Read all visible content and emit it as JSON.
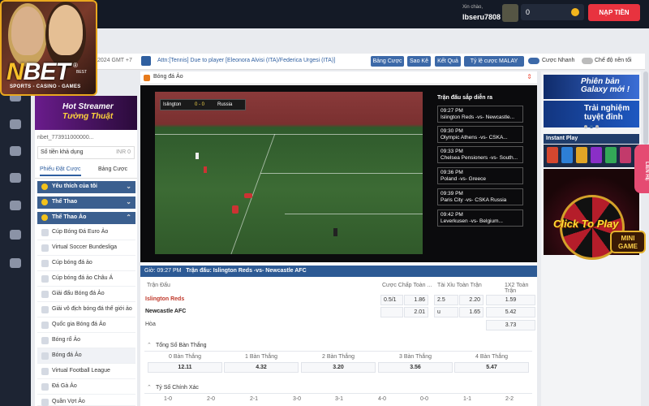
{
  "header": {
    "logo_text_a": "N",
    "logo_text_b": "BET",
    "logo_reg": "®",
    "logo_best": "BEST",
    "logo_tagline": "SPORTS - CASINO - GAMES",
    "greeting": "Xin chào,",
    "username": "lbseru7808",
    "balance": "0",
    "deposit_label": "NẠP TIỀN"
  },
  "leftpanel": {
    "promo_line1": "Hot Streamer",
    "promo_line2": "Tường Thuật",
    "account": "nbet_773911000000...",
    "balance_label": "Số tiền khả dụng",
    "balance_value": "INR 0",
    "tab1": "Phiếu Đặt Cược",
    "tab2": "Bảng Cược",
    "sections": {
      "favorites": "Yêu thích của tôi",
      "sports": "Thể Thao",
      "virtual": "Thể Thao Ảo"
    },
    "items": [
      "Cúp Bóng Đá Euro Ảo",
      "Virtual Soccer Bundesliga",
      "Cúp bóng đá ảo",
      "Cúp bóng đá ảo Châu Á",
      "Giải đấu Bóng đá Ảo",
      "Giải vô địch bóng đá thế giới ảo",
      "Quốc gia Bóng đá Ảo",
      "Bóng rổ Ảo",
      "Bóng đá Ảo",
      "Virtual Football League",
      "Đá Gà Ảo",
      "Quần Vợt Ảo"
    ]
  },
  "toolbar": {
    "timezone": "2024 GMT +7",
    "marquee": "Attn:[Tennis] Due to player [Eleonora Alvisi (ITA)/Federica Urgesi (ITA)]",
    "btn_odds_table": "Bảng Cược",
    "btn_scores": "Sao Kê",
    "btn_results": "Kết Quả",
    "btn_odds_type": "Tỷ lệ cược MALAY",
    "quick_bet": "Cược Nhanh",
    "night_mode": "Chế độ nền tối"
  },
  "main": {
    "title": "Bóng đá Ảo",
    "upcoming_title": "Trận đấu sắp diễn ra",
    "upcoming": [
      {
        "time": "09:27 PM",
        "match": "Islington Reds -vs- Newcastle..."
      },
      {
        "time": "09:30 PM",
        "match": "Olympic Athens -vs- CSKA..."
      },
      {
        "time": "09:33 PM",
        "match": "Chelsea Pensioners -vs- South..."
      },
      {
        "time": "09:36 PM",
        "match": "Poland -vs- Greece"
      },
      {
        "time": "09:39 PM",
        "match": "Paris City -vs- CSKA Russia"
      },
      {
        "time": "09:42 PM",
        "match": "Leverkusen -vs- Belgium..."
      }
    ],
    "scorebug_home": "Islington",
    "scorebug_score": "0 - 0",
    "scorebug_away": "Russia",
    "info_time_label": "Giờ: 09:27 PM",
    "info_match_label": "Trận đấu: Islington Reds -vs- Newcastle AFC",
    "cols": {
      "match": "Trận Đấu",
      "handicap": "Cược Chấp Toàn ...",
      "ou": "Tài Xỉu Toàn Trận",
      "x12": "1X2 Toàn Trận"
    },
    "teams": {
      "home": "Islington Reds",
      "away": "Newcastle AFC",
      "draw": "Hòa"
    },
    "odds": {
      "hdp_line": "0.5/1",
      "hdp_home": "1.86",
      "hdp_away": "2.01",
      "ou_line": "2.5",
      "ou_over": "2.20",
      "ou_under_label": "u",
      "ou_under": "1.65",
      "x12_home": "1.59",
      "x12_away": "5.42",
      "x12_draw": "3.73"
    },
    "total_goals": {
      "title": "Tổng Số Bàn Thắng",
      "labels": [
        "0 Bàn Thắng",
        "1 Bàn Thắng",
        "2 Bàn Thắng",
        "3 Bàn Thắng",
        "4 Bàn Thắng"
      ],
      "values": [
        "12.11",
        "4.32",
        "3.20",
        "3.56",
        "5.47"
      ]
    },
    "correct_score": {
      "title": "Tỷ Số Chính Xác",
      "labels": [
        "1-0",
        "2-0",
        "2-1",
        "3-0",
        "3-1",
        "4-0",
        "0-0",
        "1-1",
        "2-2"
      ]
    }
  },
  "right": {
    "banner1_line1": "Phiên bản",
    "banner1_line2": "Galaxy mới !",
    "banner2_line1": "Trải nghiệm",
    "banner2_line2": "tuyệt đỉnh",
    "instant_play": "Instant Play",
    "click_to_play": "Click To Play",
    "mini_game_line1": "MINI",
    "mini_game_line2": "GAME",
    "contact": "LIÊN HỆ"
  },
  "colors": {
    "topbar": "#141a26",
    "accent_blue": "#3c69a8",
    "deposit_red": "#e8333f",
    "section_blue": "#3b5f8f",
    "home_team": "#c0392b"
  }
}
